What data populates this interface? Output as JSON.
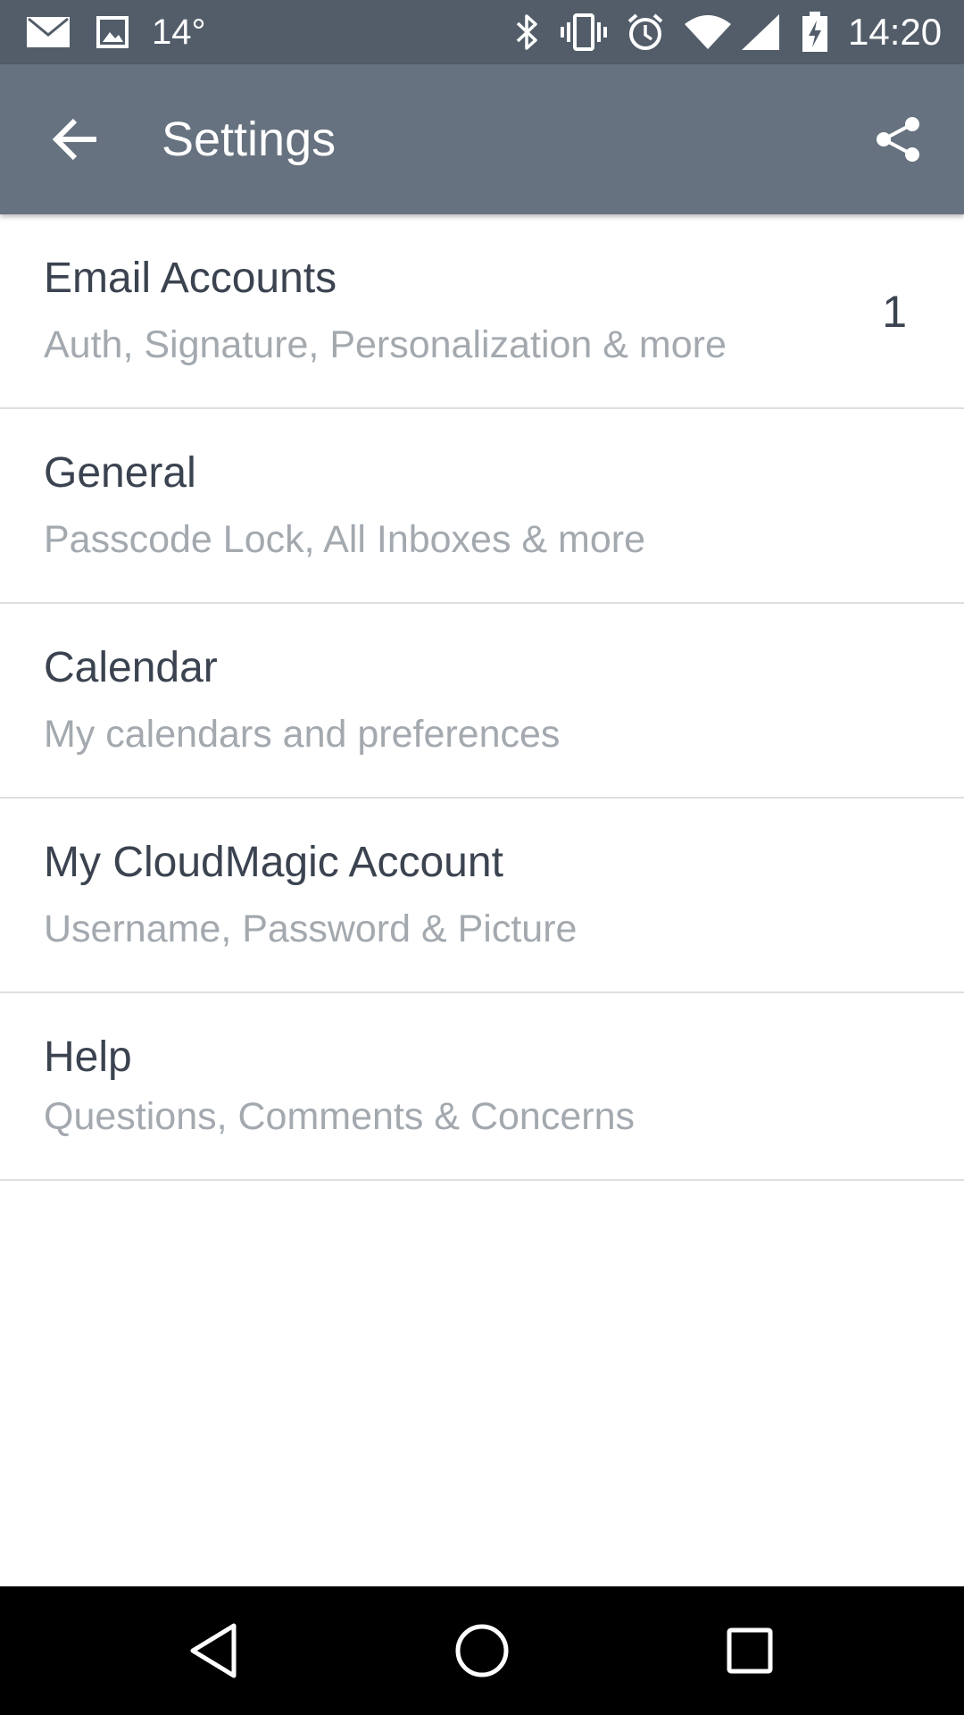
{
  "status_bar": {
    "temperature": "14°",
    "time": "14:20",
    "icons": [
      "mail-icon",
      "image-icon",
      "bluetooth-icon",
      "vibrate-icon",
      "alarm-icon",
      "wifi-icon",
      "signal-icon",
      "battery-charging-icon"
    ]
  },
  "app_bar": {
    "title": "Settings",
    "back_icon": "arrow-back-icon",
    "share_icon": "share-icon"
  },
  "settings": {
    "items": [
      {
        "title": "Email Accounts",
        "subtitle": "Auth, Signature, Personalization & more",
        "count": "1"
      },
      {
        "title": "General",
        "subtitle": "Passcode Lock, All Inboxes & more"
      },
      {
        "title": "Calendar",
        "subtitle": "My calendars and preferences"
      },
      {
        "title": "My CloudMagic Account",
        "subtitle": "Username, Password & Picture"
      },
      {
        "title": "Help",
        "subtitle": "Questions, Comments & Concerns"
      }
    ]
  },
  "nav_bar": {
    "icons": [
      "nav-back-icon",
      "nav-home-icon",
      "nav-recents-icon"
    ]
  },
  "colors": {
    "status_bar_bg": "#525d69",
    "app_bar_bg": "#66727f",
    "title_text": "#3b4350",
    "subtitle_text": "#a3a9af",
    "divider": "#dcdfe2",
    "nav_bar_bg": "#000000"
  }
}
